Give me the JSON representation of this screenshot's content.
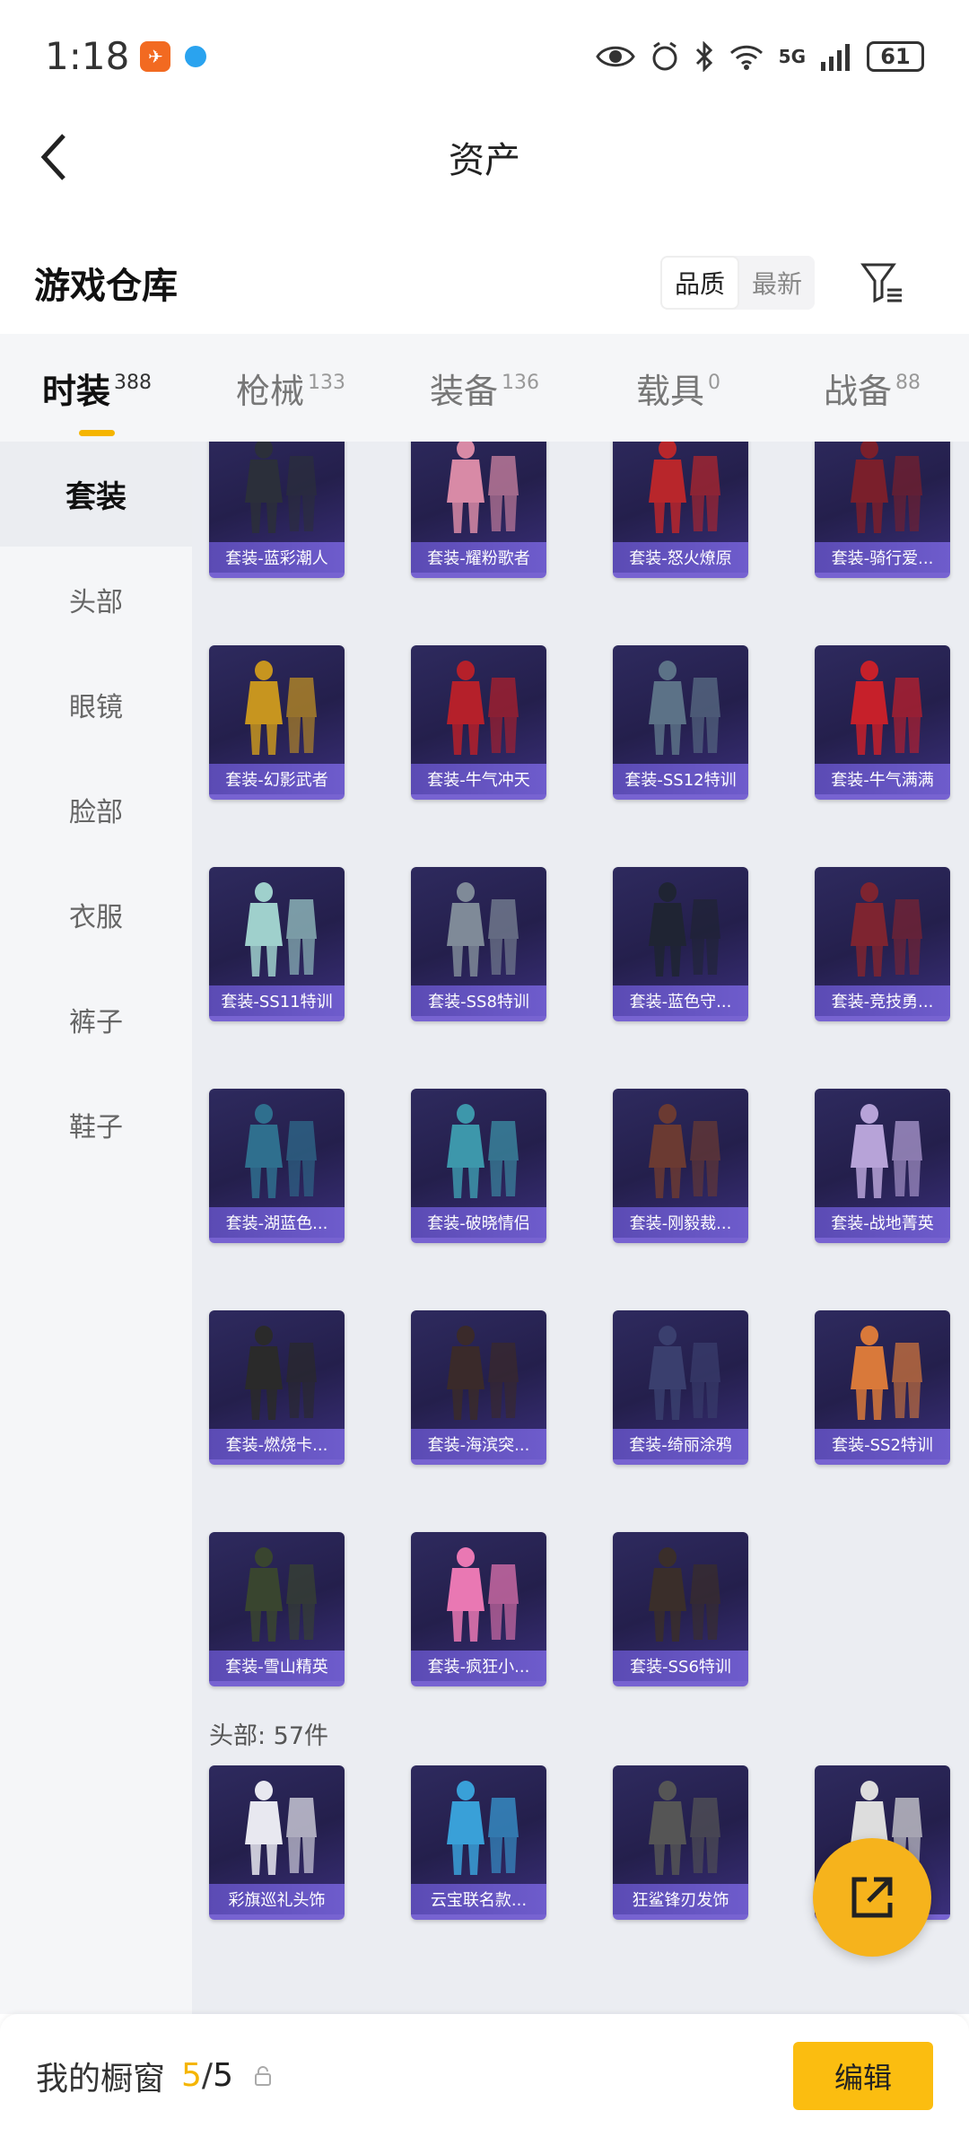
{
  "status_bar": {
    "time": "1:18",
    "network": "5G",
    "battery": "61"
  },
  "header": {
    "title": "资产"
  },
  "section": {
    "title": "游戏仓库",
    "sort_options": [
      "品质",
      "最新"
    ],
    "active_sort": "品质"
  },
  "tabs": [
    {
      "label": "时装",
      "count": "388",
      "active": true
    },
    {
      "label": "枪械",
      "count": "133",
      "active": false
    },
    {
      "label": "装备",
      "count": "136",
      "active": false
    },
    {
      "label": "载具",
      "count": "0",
      "active": false
    },
    {
      "label": "战备",
      "count": "88",
      "active": false
    }
  ],
  "sidebar": {
    "items": [
      {
        "label": "套装",
        "active": true
      },
      {
        "label": "头部",
        "active": false
      },
      {
        "label": "眼镜",
        "active": false
      },
      {
        "label": "脸部",
        "active": false
      },
      {
        "label": "衣服",
        "active": false
      },
      {
        "label": "裤子",
        "active": false
      },
      {
        "label": "鞋子",
        "active": false
      }
    ]
  },
  "suits": [
    {
      "label": "套装-蓝彩潮人",
      "color": "#2b2f3a"
    },
    {
      "label": "套装-耀粉歌者",
      "color": "#d88aa6"
    },
    {
      "label": "套装-怒火燎原",
      "color": "#b8262b"
    },
    {
      "label": "套装-骑行爱...",
      "color": "#7a1f2b"
    },
    {
      "label": "套装-幻影武者",
      "color": "#c7951f"
    },
    {
      "label": "套装-牛气冲天",
      "color": "#b5202a"
    },
    {
      "label": "套装-SS12特训",
      "color": "#5c7287"
    },
    {
      "label": "套装-牛气满满",
      "color": "#c6202a"
    },
    {
      "label": "套装-SS11特训",
      "color": "#9fd0cc"
    },
    {
      "label": "套装-SS8特训",
      "color": "#7f8a98"
    },
    {
      "label": "套装-蓝色守...",
      "color": "#1f2433"
    },
    {
      "label": "套装-竞技勇...",
      "color": "#7e2430"
    },
    {
      "label": "套装-湖蓝色...",
      "color": "#2f6f8e"
    },
    {
      "label": "套装-破晓情侣",
      "color": "#3d97ab"
    },
    {
      "label": "套装-刚毅裁...",
      "color": "#6b3a32"
    },
    {
      "label": "套装-战地菁英",
      "color": "#b7a3d8"
    },
    {
      "label": "套装-燃烧卡...",
      "color": "#2a2a2a"
    },
    {
      "label": "套装-海滨突...",
      "color": "#3a2a2a"
    },
    {
      "label": "套装-绮丽涂鸦",
      "color": "#3a3f6e"
    },
    {
      "label": "套装-SS2特训",
      "color": "#d9793a"
    },
    {
      "label": "套装-雪山精英",
      "color": "#39452f"
    },
    {
      "label": "套装-疯狂小...",
      "color": "#e978b3"
    },
    {
      "label": "套装-SS6特训",
      "color": "#3a2e2a"
    }
  ],
  "head_section": {
    "label": "头部: 57件",
    "items": [
      {
        "label": "彩旗巡礼头饰",
        "color": "#e8e8f0"
      },
      {
        "label": "云宝联名款...",
        "color": "#39a0d8"
      },
      {
        "label": "狂鲨锋刃发饰",
        "color": "#555555"
      },
      {
        "label": "",
        "color": "#dddddd"
      }
    ]
  },
  "bottom_bar": {
    "label": "我的橱窗",
    "used": "5",
    "total": "5",
    "edit_label": "编辑"
  }
}
